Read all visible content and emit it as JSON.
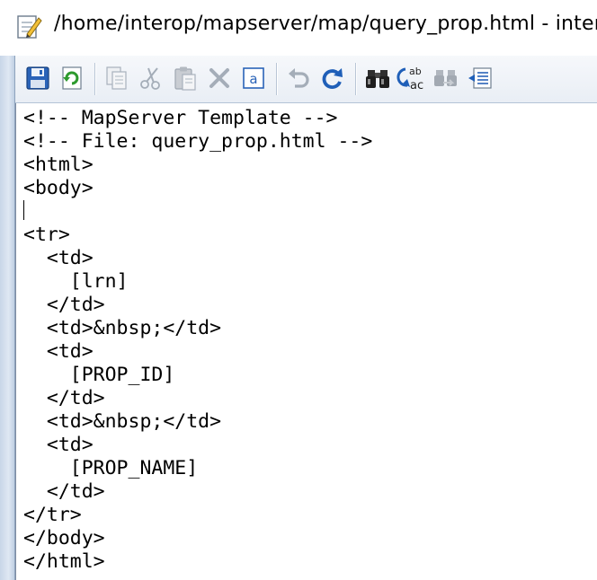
{
  "window": {
    "title": "/home/interop/mapserver/map/query_prop.html - intero"
  },
  "toolbar": {
    "buttons": [
      {
        "name": "save",
        "icon": "save-icon",
        "enabled": true
      },
      {
        "name": "reload",
        "icon": "reload-icon",
        "enabled": true
      },
      {
        "name": "copy",
        "icon": "copy-icon",
        "enabled": false
      },
      {
        "name": "cut",
        "icon": "scissors-icon",
        "enabled": false
      },
      {
        "name": "paste",
        "icon": "paste-icon",
        "enabled": false
      },
      {
        "name": "delete",
        "icon": "delete-icon",
        "enabled": false
      },
      {
        "name": "select-all",
        "icon": "select-all-icon",
        "enabled": true,
        "glyph": "a"
      },
      {
        "name": "undo",
        "icon": "undo-icon",
        "enabled": false
      },
      {
        "name": "redo",
        "icon": "redo-icon",
        "enabled": true
      },
      {
        "name": "find",
        "icon": "binoculars-icon",
        "enabled": true
      },
      {
        "name": "replace",
        "icon": "find-replace-icon",
        "enabled": true,
        "glyph_top": "ab",
        "glyph_bottom": "ac"
      },
      {
        "name": "find-next",
        "icon": "find-next-icon",
        "enabled": false
      },
      {
        "name": "goto-line",
        "icon": "goto-line-icon",
        "enabled": true
      }
    ]
  },
  "editor": {
    "lines": [
      "<!-- MapServer Template -->",
      "<!-- File: query_prop.html -->",
      "<html>",
      "<body>",
      "",
      "<tr>",
      "  <td>",
      "    [lrn]",
      "  </td>",
      "  <td>&nbsp;</td>",
      "  <td>",
      "    [PROP_ID]",
      "  </td>",
      "  <td>&nbsp;</td>",
      "  <td>",
      "    [PROP_NAME]",
      "  </td>",
      "</tr>",
      "</body>",
      "</html>"
    ],
    "cursor_line": 4
  },
  "colors": {
    "accent_blue": "#1f5fb8",
    "green": "#2e9a2e",
    "disabled_gray": "#9aa4b0"
  }
}
